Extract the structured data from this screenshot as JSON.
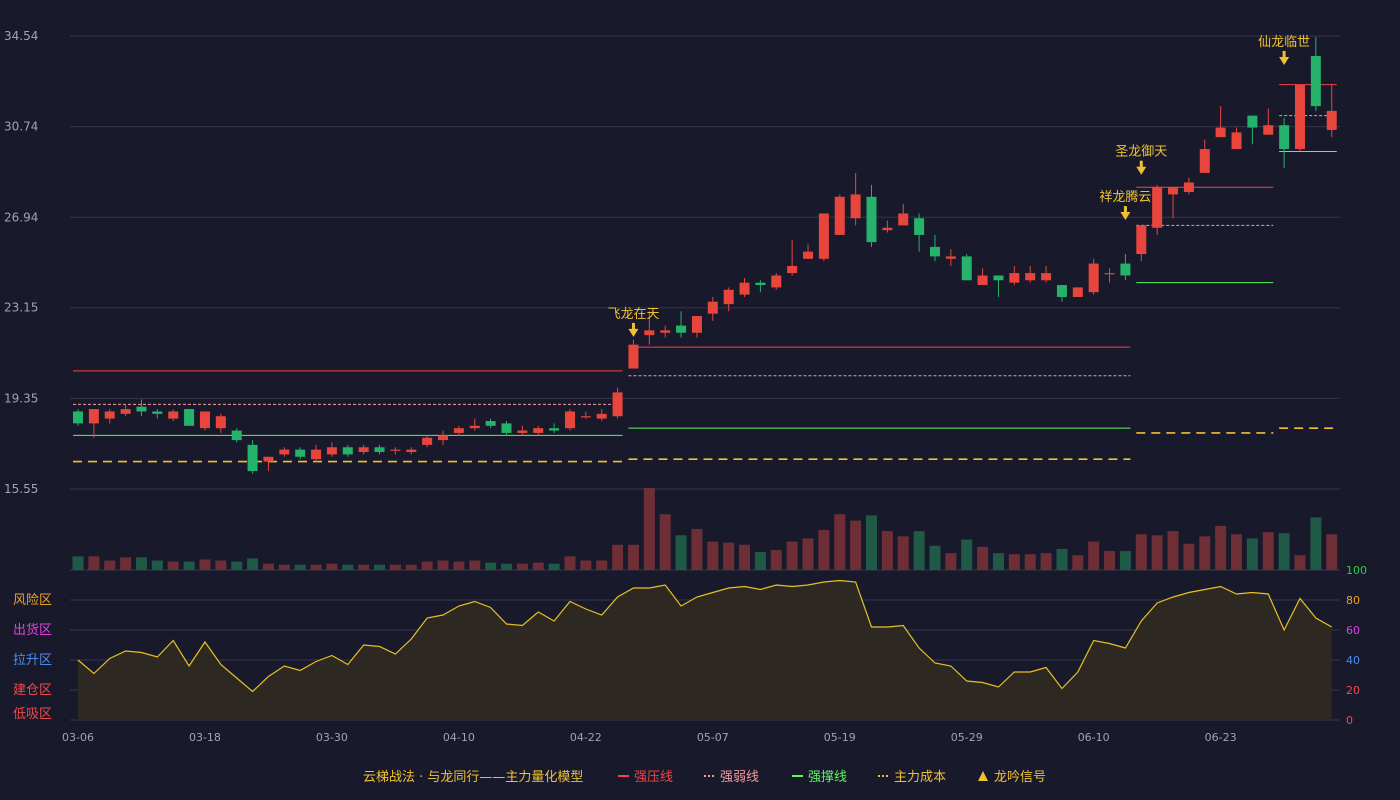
{
  "chart_data": {
    "type": "candlestick",
    "price_axis": {
      "ticks": [
        "34.54",
        "30.74",
        "26.94",
        "23.15",
        "19.35",
        "15.55"
      ],
      "ylim": [
        15.55,
        34.54
      ]
    },
    "x_tick_labels": [
      {
        "index": 0,
        "label": "03-06"
      },
      {
        "index": 8,
        "label": "03-18"
      },
      {
        "index": 16,
        "label": "03-30"
      },
      {
        "index": 24,
        "label": "04-10"
      },
      {
        "index": 32,
        "label": "04-22"
      },
      {
        "index": 40,
        "label": "05-07"
      },
      {
        "index": 48,
        "label": "05-19"
      },
      {
        "index": 56,
        "label": "05-29"
      },
      {
        "index": 64,
        "label": "06-10"
      },
      {
        "index": 72,
        "label": "06-23"
      }
    ],
    "candles": [
      [
        18.8,
        18.3,
        18.9,
        18.2
      ],
      [
        18.3,
        18.9,
        18.9,
        17.7
      ],
      [
        18.5,
        18.8,
        18.9,
        18.3
      ],
      [
        18.7,
        18.9,
        19.1,
        18.6
      ],
      [
        19.0,
        18.8,
        19.3,
        18.6
      ],
      [
        18.8,
        18.7,
        18.9,
        18.5
      ],
      [
        18.5,
        18.8,
        18.9,
        18.4
      ],
      [
        18.9,
        18.2,
        18.9,
        18.2
      ],
      [
        18.1,
        18.8,
        18.8,
        18.0
      ],
      [
        18.1,
        18.6,
        18.7,
        17.9
      ],
      [
        18.0,
        17.6,
        18.1,
        17.5
      ],
      [
        17.4,
        16.3,
        17.6,
        16.2
      ],
      [
        16.7,
        16.9,
        16.9,
        16.3
      ],
      [
        17.0,
        17.2,
        17.3,
        16.9
      ],
      [
        17.2,
        16.9,
        17.3,
        16.8
      ],
      [
        16.8,
        17.2,
        17.4,
        16.7
      ],
      [
        17.0,
        17.3,
        17.5,
        16.9
      ],
      [
        17.3,
        17.0,
        17.4,
        16.9
      ],
      [
        17.1,
        17.3,
        17.4,
        17.0
      ],
      [
        17.3,
        17.1,
        17.4,
        17.0
      ],
      [
        17.2,
        17.2,
        17.3,
        17.0
      ],
      [
        17.1,
        17.2,
        17.3,
        17.0
      ],
      [
        17.4,
        17.7,
        17.8,
        17.3
      ],
      [
        17.6,
        17.8,
        18.0,
        17.4
      ],
      [
        17.9,
        18.1,
        18.2,
        17.8
      ],
      [
        18.1,
        18.2,
        18.5,
        18.0
      ],
      [
        18.4,
        18.2,
        18.5,
        18.1
      ],
      [
        18.3,
        17.9,
        18.4,
        17.8
      ],
      [
        17.9,
        18.0,
        18.2,
        17.8
      ],
      [
        17.9,
        18.1,
        18.2,
        17.8
      ],
      [
        18.1,
        18.0,
        18.3,
        17.9
      ],
      [
        18.1,
        18.8,
        18.9,
        18.0
      ],
      [
        18.6,
        18.6,
        18.8,
        18.5
      ],
      [
        18.5,
        18.7,
        18.9,
        18.4
      ],
      [
        18.6,
        19.6,
        19.8,
        18.5
      ],
      [
        20.6,
        21.6,
        21.8,
        20.6
      ],
      [
        22.0,
        22.2,
        23.0,
        21.6
      ],
      [
        22.1,
        22.2,
        22.4,
        21.9
      ],
      [
        22.4,
        22.1,
        23.0,
        21.9
      ],
      [
        22.1,
        22.8,
        22.8,
        21.9
      ],
      [
        22.9,
        23.4,
        23.6,
        22.6
      ],
      [
        23.3,
        23.9,
        24.0,
        23.0
      ],
      [
        23.7,
        24.2,
        24.4,
        23.6
      ],
      [
        24.2,
        24.1,
        24.3,
        23.8
      ],
      [
        24.0,
        24.5,
        24.6,
        23.9
      ],
      [
        24.6,
        24.9,
        26.0,
        24.5
      ],
      [
        25.2,
        25.5,
        25.8,
        25.2
      ],
      [
        25.2,
        27.1,
        27.1,
        25.1
      ],
      [
        26.2,
        27.8,
        27.9,
        26.3
      ],
      [
        26.9,
        27.9,
        28.8,
        26.6
      ],
      [
        27.8,
        25.9,
        28.3,
        25.7
      ],
      [
        26.4,
        26.5,
        26.8,
        26.3
      ],
      [
        26.6,
        27.1,
        27.5,
        26.7
      ],
      [
        26.9,
        26.2,
        27.1,
        25.5
      ],
      [
        25.7,
        25.3,
        26.2,
        25.1
      ],
      [
        25.2,
        25.3,
        25.6,
        24.9
      ],
      [
        25.3,
        24.3,
        25.4,
        24.3
      ],
      [
        24.1,
        24.5,
        24.8,
        24.1
      ],
      [
        24.5,
        24.3,
        24.5,
        23.6
      ],
      [
        24.2,
        24.6,
        24.9,
        24.1
      ],
      [
        24.3,
        24.6,
        24.9,
        24.2
      ],
      [
        24.3,
        24.6,
        24.9,
        24.2
      ],
      [
        24.1,
        23.6,
        24.1,
        23.4
      ],
      [
        23.6,
        24.0,
        24.0,
        23.6
      ],
      [
        23.8,
        25.0,
        25.2,
        23.7
      ],
      [
        24.6,
        24.6,
        24.8,
        24.2
      ],
      [
        25.0,
        24.5,
        25.4,
        24.3
      ],
      [
        25.4,
        26.6,
        26.6,
        25.1
      ],
      [
        26.5,
        28.2,
        28.3,
        26.2
      ],
      [
        27.9,
        28.2,
        28.2,
        26.9
      ],
      [
        28.0,
        28.4,
        28.6,
        27.9
      ],
      [
        28.8,
        29.8,
        30.2,
        28.8
      ],
      [
        30.3,
        30.7,
        31.6,
        30.3
      ],
      [
        29.8,
        30.5,
        30.7,
        29.9
      ],
      [
        31.2,
        30.7,
        31.2,
        30.0
      ],
      [
        30.4,
        30.8,
        31.5,
        30.7
      ],
      [
        30.8,
        29.8,
        31.1,
        29.0
      ],
      [
        29.8,
        32.5,
        32.5,
        29.7
      ],
      [
        33.7,
        31.6,
        34.5,
        31.4
      ],
      [
        30.6,
        31.4,
        32.5,
        30.3
      ]
    ],
    "volumes": [
      13,
      13,
      9,
      12,
      12,
      9,
      8,
      8,
      10,
      9,
      8,
      11,
      6,
      5,
      5,
      5,
      6,
      5,
      5,
      5,
      5,
      5,
      8,
      9,
      8,
      9,
      7,
      6,
      6,
      7,
      6,
      13,
      9,
      9,
      24,
      24,
      78,
      53,
      33,
      39,
      27,
      26,
      24,
      17,
      19,
      27,
      30,
      38,
      53,
      47,
      52,
      37,
      32,
      37,
      23,
      16,
      29,
      22,
      16,
      15,
      15,
      16,
      20,
      14,
      27,
      18,
      18,
      34,
      33,
      37,
      25,
      32,
      42,
      34,
      30,
      36,
      35,
      14,
      50,
      34
    ],
    "oscillator": {
      "y_ticks": [
        0,
        20,
        40,
        60,
        80,
        100
      ],
      "zone_labels": [
        "风险区",
        "出货区",
        "拉升区",
        "建仓区",
        "低吸区"
      ],
      "values": [
        40,
        31,
        41,
        46,
        45,
        42,
        53,
        36,
        52,
        37,
        28,
        19,
        29,
        36,
        33,
        39,
        43,
        37,
        50,
        49,
        44,
        54,
        68,
        70,
        76,
        79,
        75,
        64,
        63,
        72,
        66,
        79,
        74,
        70,
        82,
        88,
        88,
        90,
        76,
        82,
        85,
        88,
        89,
        87,
        90,
        89,
        90,
        92,
        93,
        92,
        62,
        62,
        63,
        48,
        38,
        36,
        26,
        25,
        22,
        32,
        32,
        35,
        21,
        32,
        53,
        51,
        48,
        66,
        78,
        82,
        85,
        87,
        89,
        84,
        85,
        84,
        60,
        81,
        68,
        62
      ]
    },
    "levels": [
      {
        "type": "强压线",
        "from": 0,
        "to": 34,
        "value": 20.5
      },
      {
        "type": "强弱线",
        "from": 0,
        "to": 34,
        "value": 19.1
      },
      {
        "type": "强撑线",
        "from": 0,
        "to": 34,
        "value": 17.8
      },
      {
        "type": "主力成本",
        "from": 0,
        "to": 34,
        "value": 16.7
      },
      {
        "type": "强压线",
        "from": 35,
        "to": 66,
        "value": 21.5
      },
      {
        "type": "强弱线",
        "from": 35,
        "to": 66,
        "value": 20.3
      },
      {
        "type": "强撑线",
        "from": 35,
        "to": 66,
        "value": 18.1
      },
      {
        "type": "主力成本",
        "from": 35,
        "to": 66,
        "value": 16.8
      },
      {
        "type": "强压线",
        "from": 67,
        "to": 75,
        "value": 28.2
      },
      {
        "type": "强弱线",
        "from": 67,
        "to": 75,
        "value": 26.6
      },
      {
        "type": "强撑线",
        "from": 67,
        "to": 75,
        "value": 24.2
      },
      {
        "type": "主力成本",
        "from": 67,
        "to": 75,
        "value": 17.9
      },
      {
        "type": "强压线",
        "from": 76,
        "to": 79,
        "value": 32.5
      },
      {
        "type": "强弱线",
        "from": 76,
        "to": 79,
        "value": 31.2
      },
      {
        "type": "强撑线",
        "from": 76,
        "to": 79,
        "value": 29.7
      },
      {
        "type": "主力成本",
        "from": 76,
        "to": 79,
        "value": 18.1
      }
    ],
    "signals": [
      {
        "index": 35,
        "label": "飞龙在天",
        "price": 21.8
      },
      {
        "index": 66,
        "label": "祥龙腾云",
        "price": 26.7
      },
      {
        "index": 67,
        "label": "圣龙御天",
        "price": 28.6
      },
      {
        "index": 76,
        "label": "仙龙临世",
        "price": 33.2
      }
    ],
    "legend": {
      "title": "云梯战法 · 与龙同行——主力量化模型",
      "items": [
        {
          "label": "强压线",
          "symbol": "—",
          "color": "#f04444"
        },
        {
          "label": "强弱线",
          "symbol": "---",
          "color": "#f59a9a"
        },
        {
          "label": "强撑线",
          "symbol": "—",
          "color": "#5ef55e"
        },
        {
          "label": "主力成本",
          "symbol": "---",
          "color": "#f0c030"
        },
        {
          "label": "龙吟信号",
          "symbol": "▲",
          "color": "#f0c030"
        }
      ]
    },
    "colors": {
      "background": "#181a2c",
      "up": "#e8463c",
      "down": "#25b26a",
      "grid": "#33364a",
      "axis_text": "#a0a3b4",
      "signal": "#f0c030",
      "oscillator_line": "#e8c020",
      "oscillator_fill": "#2e2a22",
      "zone_risk": "#f0a020",
      "zone_sell": "#e040e0",
      "zone_rise": "#4a8cf0",
      "zone_build": "#f04a4a",
      "zone_low": "#f04a4a",
      "osc_tick_100": "#2ecc40",
      "osc_tick_80": "#f0a020",
      "osc_tick_60": "#e040e0",
      "osc_tick_40": "#4a8cf0",
      "osc_tick_20": "#f04a4a",
      "osc_tick_0": "#f04a4a"
    }
  }
}
